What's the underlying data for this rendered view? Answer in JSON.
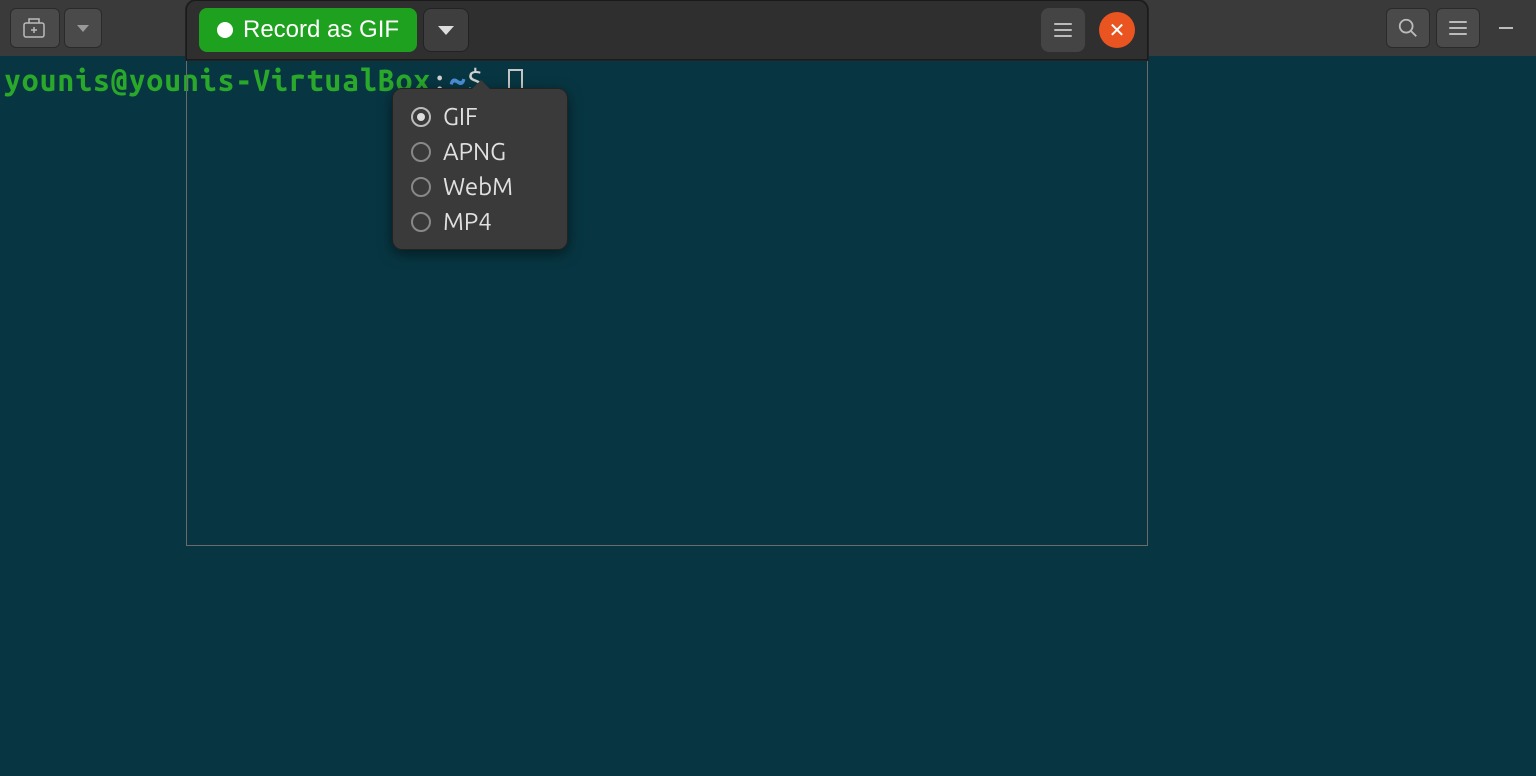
{
  "terminal": {
    "user_host": "younis@younis-VirtualBox",
    "separator": ":",
    "path": "~",
    "prompt_symbol": "$"
  },
  "recorder": {
    "record_label": "Record as GIF",
    "formats": [
      {
        "label": "GIF",
        "selected": true
      },
      {
        "label": "APNG",
        "selected": false
      },
      {
        "label": "WebM",
        "selected": false
      },
      {
        "label": "MP4",
        "selected": false
      }
    ]
  }
}
